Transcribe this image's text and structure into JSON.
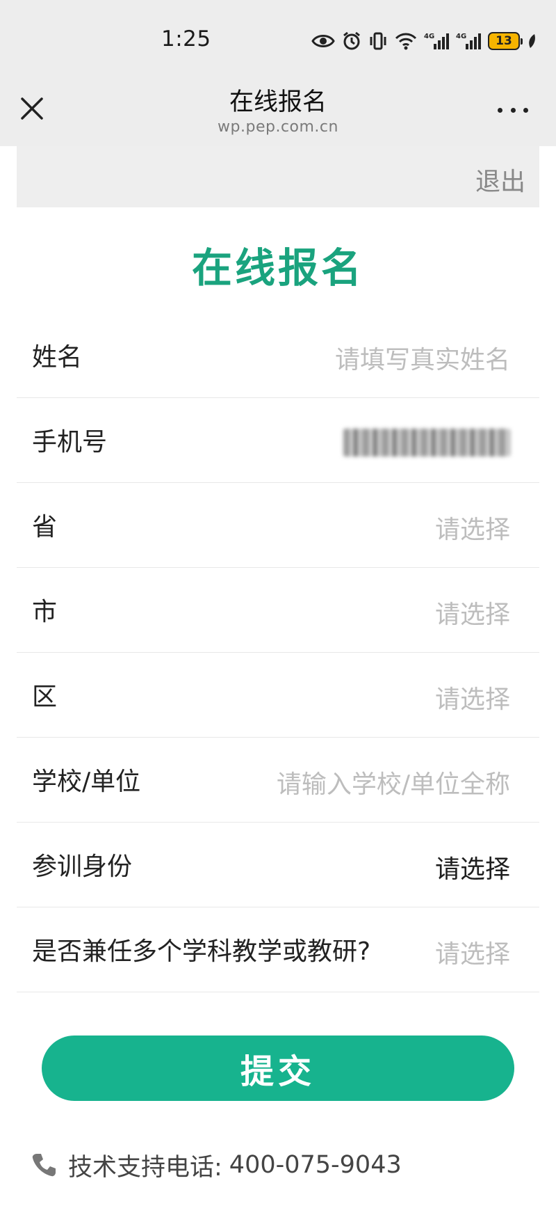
{
  "status_bar": {
    "time": "1:25",
    "battery_level": "13",
    "icons": [
      "eye-icon",
      "alarm-icon",
      "vibrate-icon",
      "wifi-icon",
      "signal-4g-icon",
      "signal-4g-icon",
      "battery-icon",
      "leaf-icon"
    ],
    "battery_color": "#f6b400"
  },
  "header": {
    "title": "在线报名",
    "subtitle": "wp.pep.com.cn"
  },
  "logout_label": "退出",
  "page_title": "在线报名",
  "form": {
    "rows": [
      {
        "label": "姓名",
        "value": "请填写真实姓名",
        "state": "placeholder"
      },
      {
        "label": "手机号",
        "value": "",
        "state": "blurred"
      },
      {
        "label": "省",
        "value": "请选择",
        "state": "placeholder"
      },
      {
        "label": "市",
        "value": "请选择",
        "state": "placeholder"
      },
      {
        "label": "区",
        "value": "请选择",
        "state": "placeholder"
      },
      {
        "label": "学校/单位",
        "value": "请输入学校/单位全称",
        "state": "placeholder"
      },
      {
        "label": "参训身份",
        "value": "请选择",
        "state": "selected"
      },
      {
        "label": "是否兼任多个学科教学或教研?",
        "value": "请选择",
        "state": "placeholder"
      }
    ]
  },
  "submit_label": "提交",
  "support": {
    "label": "技术支持电话:",
    "phone": "400-075-9043",
    "icon": "phone-icon"
  },
  "colors": {
    "accent": "#1aa37e",
    "button": "#17b38e",
    "placeholder": "#bdbdbd",
    "header_bg": "#ededed"
  }
}
